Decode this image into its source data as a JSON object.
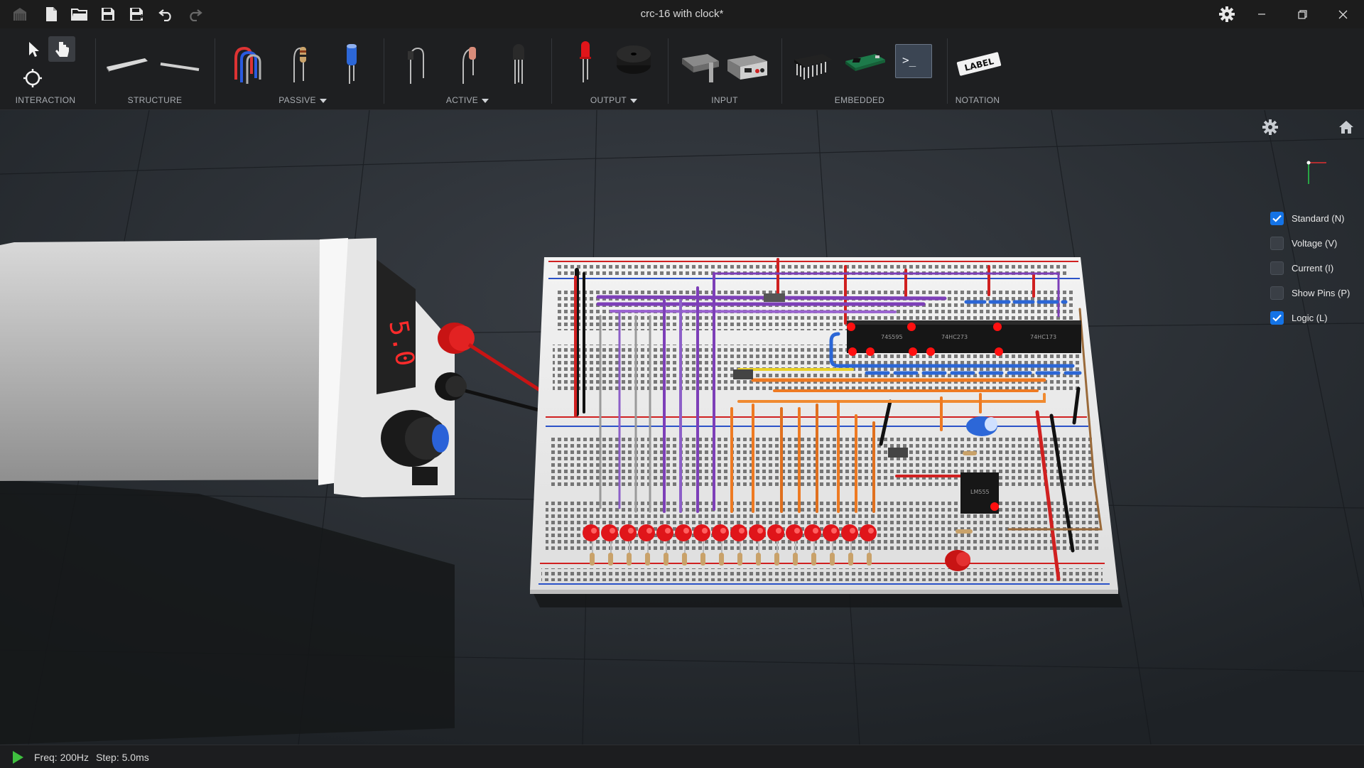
{
  "window": {
    "title": "crc-16 with clock*"
  },
  "titlebar": {
    "icons": [
      "app-logo-icon",
      "new-file-icon",
      "open-folder-icon",
      "save-icon",
      "save-as-icon",
      "undo-icon",
      "redo-icon"
    ],
    "settings_icon": "gear-icon",
    "controls": [
      "minimize-icon",
      "restore-icon",
      "close-icon"
    ]
  },
  "toolbar": {
    "groups": [
      {
        "label": "INTERACTION",
        "dropdown": false
      },
      {
        "label": "STRUCTURE",
        "dropdown": false
      },
      {
        "label": "PASSIVE",
        "dropdown": true
      },
      {
        "label": "ACTIVE",
        "dropdown": true
      },
      {
        "label": "OUTPUT",
        "dropdown": true
      },
      {
        "label": "INPUT",
        "dropdown": false
      },
      {
        "label": "EMBEDDED",
        "dropdown": false
      },
      {
        "label": "NOTATION",
        "dropdown": false
      }
    ],
    "tools": [
      "select-pointer-icon",
      "hand-pointer-icon",
      "orbit-icon",
      "breadboard-tool",
      "wire-tool",
      "jumper-wire-tool",
      "resistor-tool",
      "capacitor-tool",
      "diode-tool",
      "led-resistor-tool",
      "transistor-tool",
      "led-tool",
      "buzzer-tool",
      "switch-tool",
      "power-supply-tool",
      "ic-chip-tool",
      "microcontroller-tool",
      "terminal-tool",
      "label-tool"
    ],
    "label_tool_text": "LABEL",
    "terminal_tool_text": ">_"
  },
  "viewport": {
    "psu_display": "5.0",
    "chip_labels": [
      "74S595",
      "74HC273",
      "74HC173"
    ],
    "timer_chip_label": "LM555",
    "led_count": 16,
    "accent_colors": {
      "led": "#e0151a",
      "wire_purple": "#7d3fb8",
      "wire_orange": "#ee7a22",
      "wire_blue": "#2b66d6",
      "wire_red": "#d02020"
    }
  },
  "view_options": [
    {
      "label": "Standard (N)",
      "checked": true
    },
    {
      "label": "Voltage (V)",
      "checked": false
    },
    {
      "label": "Current (I)",
      "checked": false
    },
    {
      "label": "Show Pins (P)",
      "checked": false
    },
    {
      "label": "Logic (L)",
      "checked": true
    }
  ],
  "status": {
    "freq": "Freq: 200Hz",
    "step": "Step: 5.0ms"
  }
}
